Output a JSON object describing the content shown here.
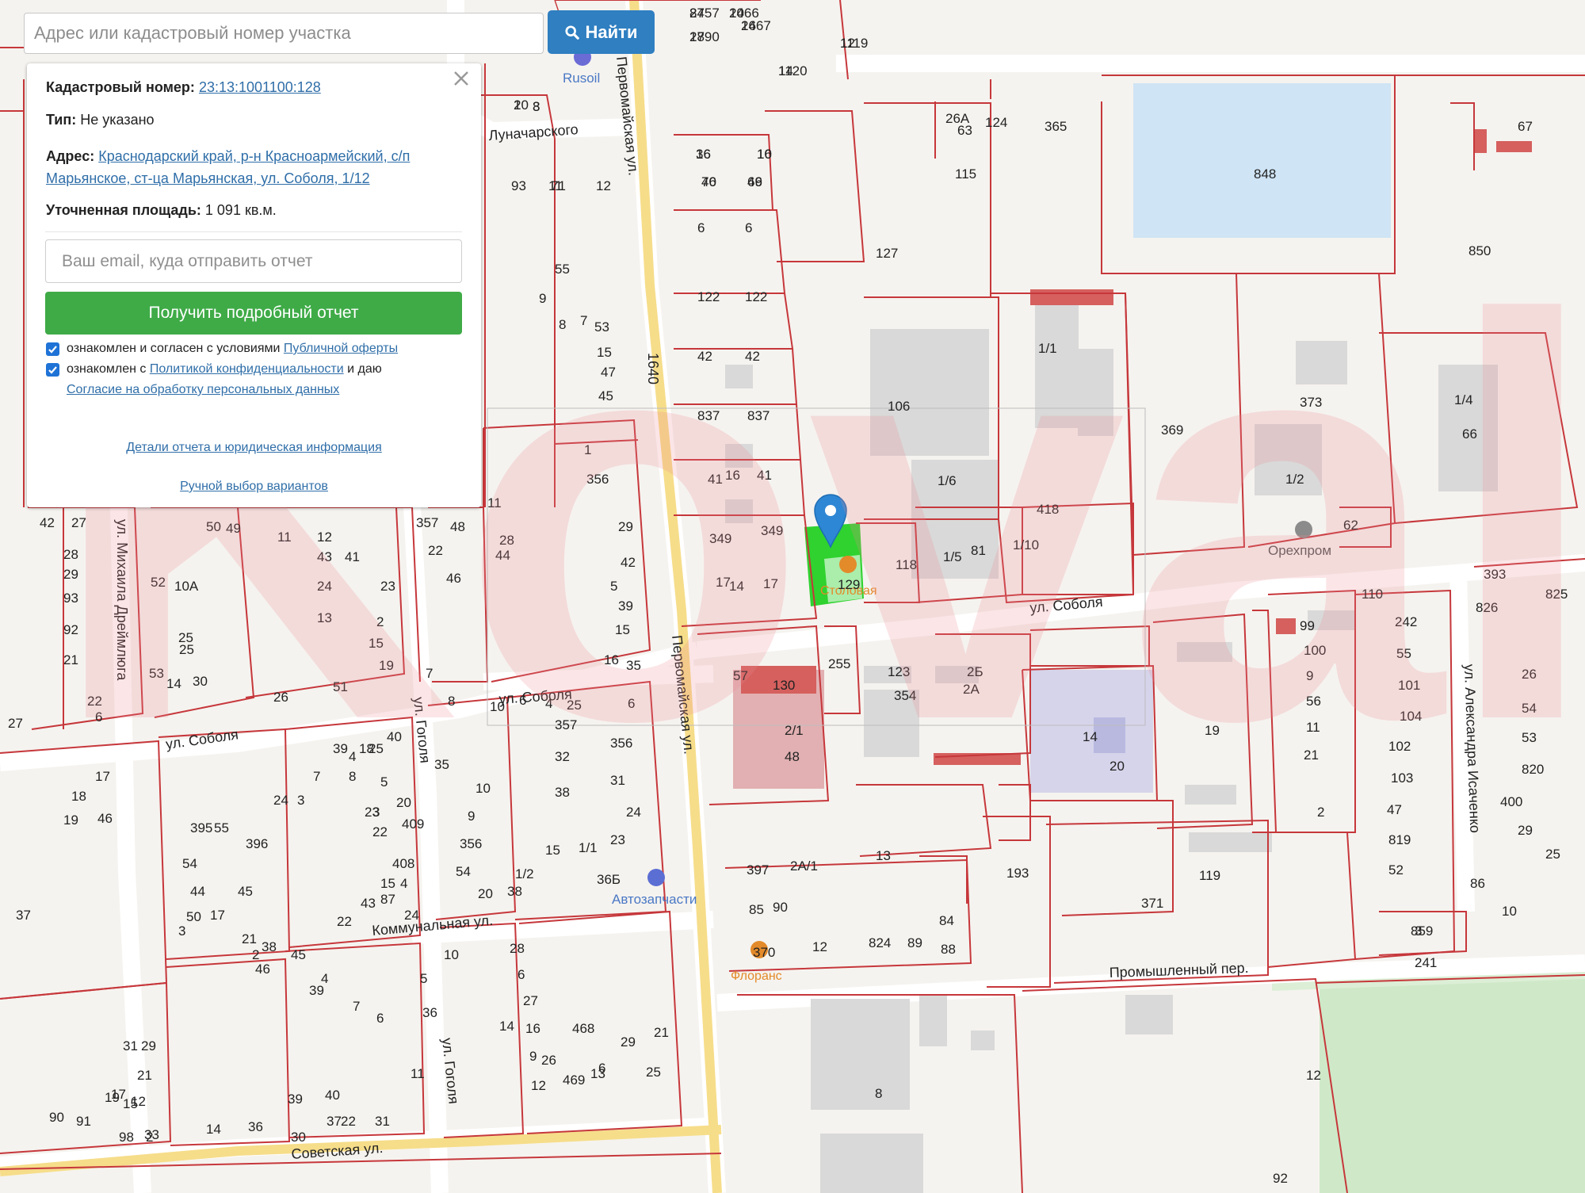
{
  "search": {
    "placeholder": "Адрес или кадастровый номер участка",
    "button_label": "Найти"
  },
  "panel": {
    "cadastral_label": "Кадастровый номер:",
    "cadastral_value": "23:13:1001100:128",
    "type_label": "Тип:",
    "type_value": "Не указано",
    "address_label": "Адрес:",
    "address_line1": "Краснодарский край, р-н Красноармейский, с/п",
    "address_line2": "Марьянское, ст-ца Марьянская, ул. Соболя, 1/12",
    "area_label": "Уточненная площадь:",
    "area_value": "1 091 кв.м.",
    "email_placeholder": "Ваш email, куда отправить отчет",
    "report_button": "Получить подробный отчет",
    "consent1_prefix": "ознакомлен и согласен с условиями",
    "consent1_link": "Публичной оферты",
    "consent2_prefix": "ознакомлен с",
    "consent2_link": "Политикой конфиденциальности",
    "consent2_suffix": "и даю",
    "consent3_link": "Согласие на обработку персональных данных",
    "details_link": "Детали отчета и юридическая информация",
    "manual_link": "Ручной выбор вариантов"
  },
  "map": {
    "watermark": "Kovale",
    "streets": {
      "pervomayskaya_1": "Первомайская ул.",
      "pervomayskaya_2": "Первомайская ул.",
      "lunacharskogo": "Луначарского",
      "sobolya_1": "ул. Соболя",
      "sobolya_2": "ул. Соболя",
      "sobolya_3": "ул. Соболя",
      "gogolya_1": "ул. Гоголя",
      "gogolya_2": "ул. Гоголя",
      "dreylyuga": "ул. Михаила Дреймлюга",
      "kommunalnaya": "Коммунальная ул.",
      "sovetskaya": "Советская ул.",
      "promyshlenny": "Промышленный пер.",
      "isachenko": "ул. Александра Исаченко"
    },
    "pois": {
      "rusoil": "Rusoil",
      "orekhprom": "Орехпром",
      "avtozapchasti": "Автозапчасти",
      "florans": "Флоранс",
      "stolovaya": "Столовая"
    },
    "road_number": "1640",
    "plots": [
      "2457",
      "2466",
      "1790",
      "2467",
      "1120",
      "1119",
      "10",
      "3",
      "16",
      "16",
      "46",
      "46",
      "26А",
      "63",
      "124",
      "365",
      "848",
      "67",
      "115",
      "127",
      "850",
      "6",
      "6",
      "122",
      "122",
      "42",
      "42",
      "837",
      "837",
      "106",
      "369",
      "373",
      "1/4",
      "66",
      "1/1",
      "16",
      "41",
      "41",
      "349",
      "349",
      "1/6",
      "418",
      "1/2",
      "62",
      "118",
      "81",
      "1/5",
      "1/10",
      "17",
      "17",
      "14",
      "129",
      "393",
      "826",
      "825",
      "110",
      "242",
      "99",
      "100",
      "55",
      "9",
      "101",
      "26",
      "56",
      "104",
      "54",
      "11",
      "102",
      "53",
      "21",
      "103",
      "820",
      "57",
      "130",
      "255",
      "123",
      "2Б",
      "2А",
      "354",
      "2/1",
      "48",
      "14",
      "20",
      "19",
      "2",
      "47",
      "400",
      "819",
      "29",
      "52",
      "25",
      "13",
      "193",
      "119",
      "397",
      "2А/1",
      "85",
      "90",
      "12",
      "824",
      "89",
      "84",
      "88",
      "370",
      "371",
      "86",
      "10",
      "3",
      "241",
      "859",
      "8",
      "12",
      "92",
      "93",
      "71",
      "11",
      "12",
      "55",
      "9",
      "8",
      "7",
      "53",
      "15",
      "47",
      "45",
      "1",
      "356",
      "357",
      "48",
      "22",
      "46",
      "44",
      "11",
      "28",
      "29",
      "42",
      "5",
      "39",
      "15",
      "35",
      "16",
      "6",
      "7",
      "8",
      "10",
      "6",
      "4",
      "25",
      "357",
      "356",
      "32",
      "31",
      "24",
      "23",
      "10",
      "9",
      "38",
      "15",
      "1/1",
      "36Б",
      "356",
      "54",
      "38",
      "20",
      "1/2",
      "25",
      "4",
      "5",
      "3",
      "409",
      "408",
      "87",
      "43",
      "42",
      "27",
      "28",
      "29",
      "93",
      "92",
      "21",
      "22",
      "6",
      "27",
      "50",
      "49",
      "11",
      "12",
      "41",
      "43",
      "24",
      "23",
      "13",
      "2",
      "15",
      "19",
      "51",
      "26",
      "30",
      "25",
      "53",
      "52",
      "10А",
      "25",
      "14",
      "40",
      "35",
      "39",
      "23",
      "22",
      "20",
      "18",
      "8",
      "7",
      "3",
      "24",
      "55",
      "396",
      "395",
      "54",
      "17",
      "19",
      "18",
      "46",
      "44",
      "50",
      "45",
      "17",
      "21",
      "3",
      "38",
      "37",
      "15",
      "4",
      "24",
      "22",
      "2",
      "45",
      "46",
      "39",
      "5",
      "6",
      "4",
      "7",
      "10",
      "36",
      "28",
      "27",
      "6",
      "16",
      "14",
      "9",
      "6",
      "29",
      "26",
      "25",
      "21",
      "468",
      "469",
      "13",
      "12",
      "11",
      "40",
      "39",
      "37",
      "36",
      "30",
      "31",
      "22",
      "15",
      "14",
      "21",
      "12",
      "17",
      "31",
      "29",
      "90",
      "91",
      "33",
      "2",
      "98",
      "19",
      "87",
      "10",
      "28",
      "16",
      "14",
      "12",
      "2",
      "8",
      "36",
      "10",
      "70",
      "69"
    ]
  }
}
